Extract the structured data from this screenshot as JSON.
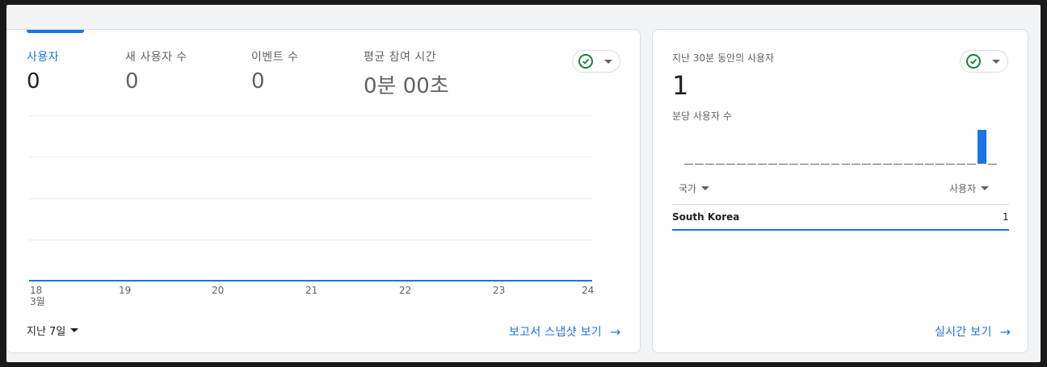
{
  "overview": {
    "metrics": [
      {
        "label": "사용자",
        "value": "0"
      },
      {
        "label": "새 사용자 수",
        "value": "0"
      },
      {
        "label": "이벤트 수",
        "value": "0"
      },
      {
        "label": "평균 참여 시간",
        "value": "0분 00초"
      }
    ],
    "x_ticks": [
      "18",
      "19",
      "20",
      "21",
      "22",
      "23",
      "24"
    ],
    "x_month": "3월",
    "range_label": "지난 7일",
    "snapshot_link": "보고서 스냅샷 보기",
    "status_icon": "check-circle-icon",
    "accent_color": "#1a73e8",
    "status_color": "#188038"
  },
  "chart_data": {
    "type": "line",
    "categories": [
      "18",
      "19",
      "20",
      "21",
      "22",
      "23",
      "24"
    ],
    "series": [
      {
        "values": [
          0,
          0,
          0,
          0,
          0,
          0,
          0
        ]
      }
    ],
    "xlabel": "3월",
    "ylabel": "",
    "grid": true
  },
  "realtime": {
    "title": "지난 30분 동안의 사용자",
    "value": "1",
    "per_minute_label": "분당 사용자 수",
    "per_minute_values": [
      0,
      0,
      0,
      0,
      0,
      0,
      0,
      0,
      0,
      0,
      0,
      0,
      0,
      0,
      0,
      0,
      0,
      0,
      0,
      0,
      0,
      0,
      0,
      0,
      0,
      0,
      0,
      0,
      1,
      0
    ],
    "table": {
      "col_country": "국가",
      "col_users": "사용자",
      "rows": [
        {
          "country": "South Korea",
          "users": "1"
        }
      ]
    },
    "realtime_link": "실시간 보기"
  }
}
